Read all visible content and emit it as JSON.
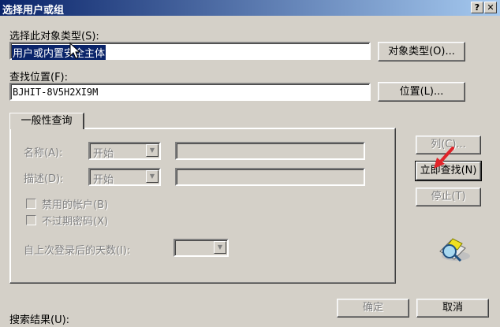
{
  "window": {
    "title": "选择用户或组",
    "help_glyph": "?",
    "close_glyph": "✕"
  },
  "object_type": {
    "label": "选择此对象类型(S):",
    "value": "用户或内置安全主体",
    "button": "对象类型(O)..."
  },
  "location": {
    "label": "查找位置(F):",
    "value": "BJHIT-8V5H2XI9M",
    "button": "位置(L)..."
  },
  "tab": {
    "label": "一般性查询"
  },
  "query": {
    "name_label": "名称(A):",
    "name_mode": "开始",
    "desc_label": "描述(D):",
    "desc_mode": "开始",
    "disabled_accounts": "禁用的帐户(B)",
    "no_expire_pwd": "不过期密码(X)",
    "days_label": "自上次登录后的天数(I):"
  },
  "buttons": {
    "columns": "列(C)...",
    "find_now": "立即查找(N)",
    "stop": "停止(T)",
    "ok": "确定",
    "cancel": "取消"
  },
  "results": {
    "label": "搜索结果(U):"
  },
  "colors": {
    "selection": "#0a246a",
    "arrow": "#e0242a"
  },
  "icons": {
    "search_graphic": "magnifier-icon"
  }
}
